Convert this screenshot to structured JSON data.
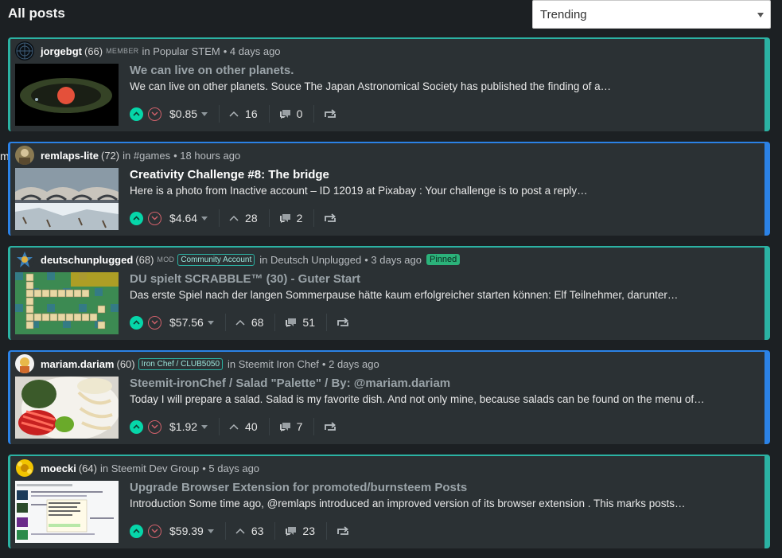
{
  "page": {
    "title": "All posts",
    "stray_char": "m"
  },
  "sort": {
    "selected": "Trending"
  },
  "posts": [
    {
      "author": "jorgebgt",
      "rep": "(66)",
      "role": "MEMBER",
      "badge": "",
      "community": "Popular STEM",
      "age": "4 days ago",
      "pinned": "",
      "title": "We can live on other planets.",
      "excerpt": "We can live on other planets. Souce The Japan Astronomical Society has published the finding of a…",
      "payout": "$0.85",
      "votes": "16",
      "comments": "0",
      "accent": "#2bb2a3"
    },
    {
      "author": "remlaps-lite",
      "rep": "(72)",
      "role": "",
      "badge": "",
      "community": "#games",
      "age": "18 hours ago",
      "pinned": "",
      "title": "Creativity Challenge #8: The bridge",
      "excerpt": "Here is a photo from Inactive account – ID 12019 at Pixabay : Your challenge is to post a reply…",
      "payout": "$4.64",
      "votes": "28",
      "comments": "2",
      "accent": "#2b82e6"
    },
    {
      "author": "deutschunplugged",
      "rep": "(68)",
      "role": "MOD",
      "badge": "Community Account",
      "community": "Deutsch Unplugged",
      "age": "3 days ago",
      "pinned": "Pinned",
      "title": "DU spielt SCRABBLE™ (30) - Guter Start",
      "excerpt": "Das erste Spiel nach der langen Sommerpause hätte kaum erfolgreicher starten können: Elf Teilnehmer, darunter…",
      "payout": "$57.56",
      "votes": "68",
      "comments": "51",
      "accent": "#2bb2a3"
    },
    {
      "author": "mariam.dariam",
      "rep": "(60)",
      "role": "",
      "badge": "Iron Chef / CLUB5050",
      "community": "Steemit Iron Chef",
      "age": "2 days ago",
      "pinned": "",
      "title": "Steemit-ironChef / Salad \"Palette\" / By: @mariam.dariam",
      "excerpt": "Today I will prepare a salad. Salad is my favorite dish. And not only mine, because salads can be found on the menu of…",
      "payout": "$1.92",
      "votes": "40",
      "comments": "7",
      "accent": "#2b82e6"
    },
    {
      "author": "moecki",
      "rep": "(64)",
      "role": "",
      "badge": "",
      "community": "Steemit Dev Group",
      "age": "5 days ago",
      "pinned": "",
      "title": "Upgrade Browser Extension for promoted/burnsteem Posts",
      "excerpt": "Introduction Some time ago, @remlaps introduced an improved version of its browser extension . This marks posts…",
      "payout": "$59.39",
      "votes": "63",
      "comments": "23",
      "accent": "#2bb2a3"
    }
  ],
  "labels": {
    "in": "in",
    "bullet": "•"
  }
}
